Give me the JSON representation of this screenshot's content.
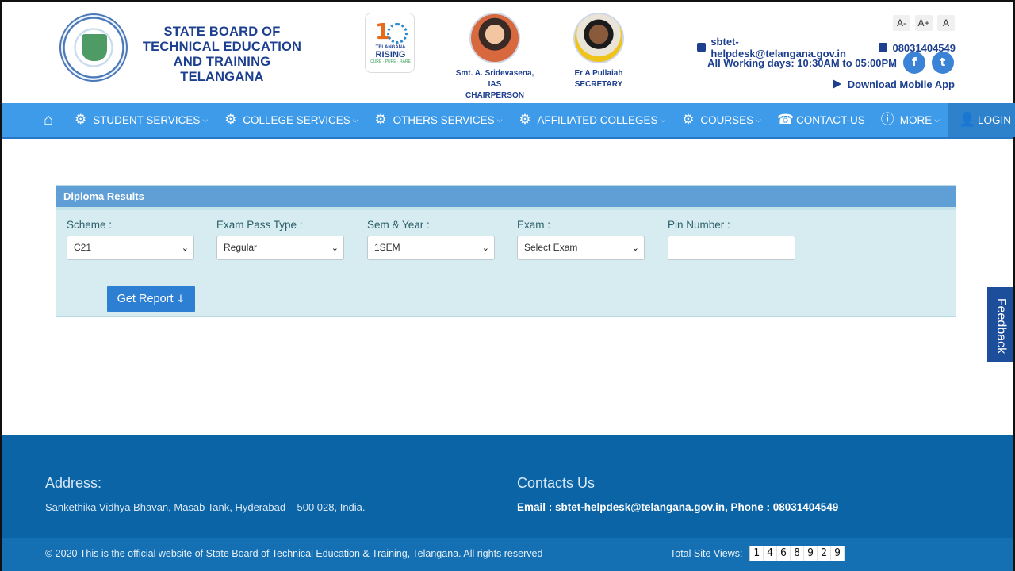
{
  "header": {
    "org_title": "STATE BOARD OF TECHNICAL EDUCATION AND TRAINING TELANGANA",
    "rising_logo": {
      "line1": "TELANGANA",
      "line2": "RISING",
      "line3": "CURE · PURE · RARE"
    },
    "person1": {
      "name": "Smt. A. Sridevasena,",
      "title1": "IAS",
      "title2": "CHAIRPERSON"
    },
    "person2": {
      "name": "Er A Pullaiah",
      "title1": "SECRETARY"
    },
    "font_tools": [
      "A-",
      "A+",
      "A"
    ],
    "email": "sbtet-helpdesk@telangana.gov.in",
    "phone": "08031404549",
    "working_days": "All Working days: 10:30AM to 05:00PM",
    "facebook_icon": "f",
    "twitter_icon": "t",
    "download_app": "Download Mobile App"
  },
  "nav": {
    "items": [
      {
        "label": "STUDENT SERVICES",
        "icon": "gear-icon"
      },
      {
        "label": "COLLEGE SERVICES",
        "icon": "gear-icon"
      },
      {
        "label": "OTHERS SERVICES",
        "icon": "gear-icon"
      },
      {
        "label": "AFFILIATED COLLEGES",
        "icon": "gear-icon"
      },
      {
        "label": "COURSES",
        "icon": "gear-icon"
      },
      {
        "label": "CONTACT-US",
        "icon": "phone-icon"
      },
      {
        "label": "MORE",
        "icon": "info-icon"
      },
      {
        "label": "LOGIN",
        "icon": "user-icon"
      }
    ]
  },
  "results": {
    "title": "Diploma Results",
    "scheme": {
      "label": "Scheme :",
      "value": "C21"
    },
    "exam_pass_type": {
      "label": "Exam Pass Type :",
      "value": "Regular"
    },
    "sem_year": {
      "label": "Sem & Year :",
      "value": "1SEM"
    },
    "exam": {
      "label": "Exam :",
      "value": "Select Exam"
    },
    "pin": {
      "label": "Pin Number :",
      "value": ""
    },
    "button": "Get Report"
  },
  "feedback": "Feedback",
  "footer": {
    "address_heading": "Address:",
    "address": "Sankethika Vidhya Bhavan, Masab Tank, Hyderabad – 500 028, India.",
    "contacts_heading": "Contacts Us",
    "contacts": "Email : sbtet-helpdesk@telangana.gov.in, Phone : 08031404549",
    "copyright": "© 2020 This is the official website of State Board of Technical Education & Training, Telangana. All rights reserved",
    "views_label": "Total Site Views:",
    "views_digits": [
      "1",
      "4",
      "6",
      "8",
      "9",
      "2",
      "9"
    ]
  },
  "colors": {
    "nav": "#3d9be9",
    "brand": "#1d3f8f",
    "footer": "#0b64a6",
    "panel": "#d6ecf0"
  }
}
